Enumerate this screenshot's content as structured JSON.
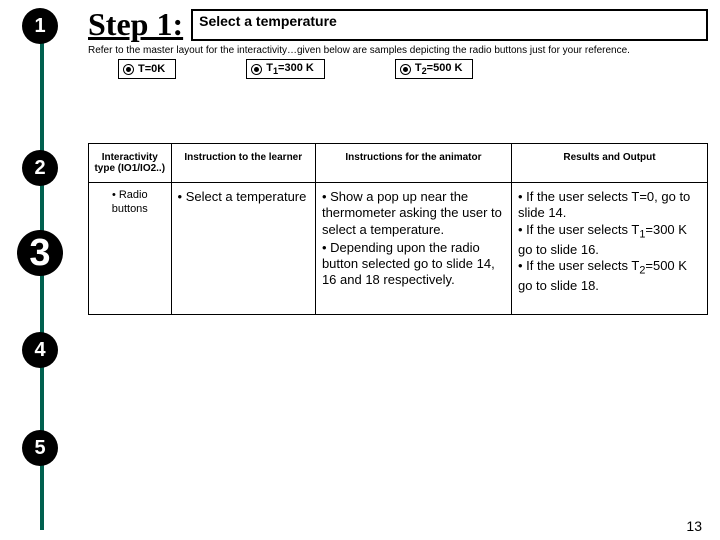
{
  "rail": {
    "steps": [
      "1",
      "2",
      "3",
      "4",
      "5"
    ],
    "large_index": 2
  },
  "title": "Step 1:",
  "step_input": "Select a temperature",
  "subtitle": "Refer to the master layout for the interactivity…given below are samples depicting the radio buttons just for your reference.",
  "radios": [
    {
      "label": "T=0K"
    },
    {
      "label_html": "T<sub>1</sub>=300 K",
      "label": "T1=300 K"
    },
    {
      "label_html": "T<sub>2</sub>=500 K",
      "label": "T2=500 K"
    }
  ],
  "table": {
    "headers": [
      "Interactivity type (IO1/IO2..)",
      "Instruction to the learner",
      "Instructions for the animator",
      "Results and Output"
    ],
    "row": {
      "iotype": "• Radio buttons",
      "instruction": "• Select a temperature",
      "animator": "• Show a pop up near the thermometer asking the user to select a temperature.\n• Depending upon the radio button selected go to slide 14, 16 and 18 respectively.",
      "results_html": "• If the user selects T=0, go to slide 14.<br>• If the user selects T<sub>1</sub>=300 K go to slide 16.<br>• If the user selects T<sub>2</sub>=500 K go to slide 18."
    },
    "col_widths": [
      "80px",
      "140px",
      "190px",
      "190px"
    ]
  },
  "page_number": "13"
}
